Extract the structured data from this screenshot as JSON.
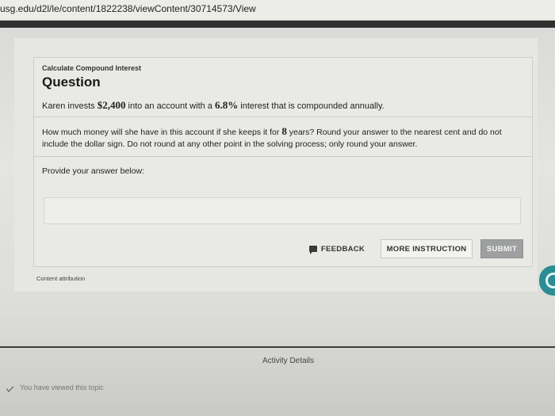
{
  "browser": {
    "url": "usg.edu/d2l/le/content/1822238/viewContent/30714573/View"
  },
  "question": {
    "kicker": "Calculate Compound Interest",
    "title": "Question",
    "statement": {
      "pre": "Karen invests ",
      "amount": "$2,400",
      "mid": " into an account with a ",
      "rate": "6.8%",
      "post": " interest that is compounded annually."
    },
    "prompt": {
      "pre": "How much money will she have in this account if she keeps it for ",
      "years": "8",
      "post": " years? Round your answer to the nearest cent and do not include the dollar sign. Do not round at any other point in the solving process; only round your answer."
    },
    "answer_label": "Provide your answer below:",
    "answer_value": "",
    "answer_placeholder": ""
  },
  "buttons": {
    "feedback": "FEEDBACK",
    "more_instruction": "MORE INSTRUCTION",
    "submit": "SUBMIT"
  },
  "attribution": "Content attribution",
  "footer": {
    "activity_details": "Activity Details",
    "viewed": "You have viewed this topic"
  },
  "icons": {
    "feedback": "speech-bubble-icon",
    "side_tab": "arrow-circle-icon",
    "viewed": "check-icon"
  },
  "colors": {
    "side_tab": "#2b8c93",
    "submit_bg": "#9e9fa0"
  }
}
